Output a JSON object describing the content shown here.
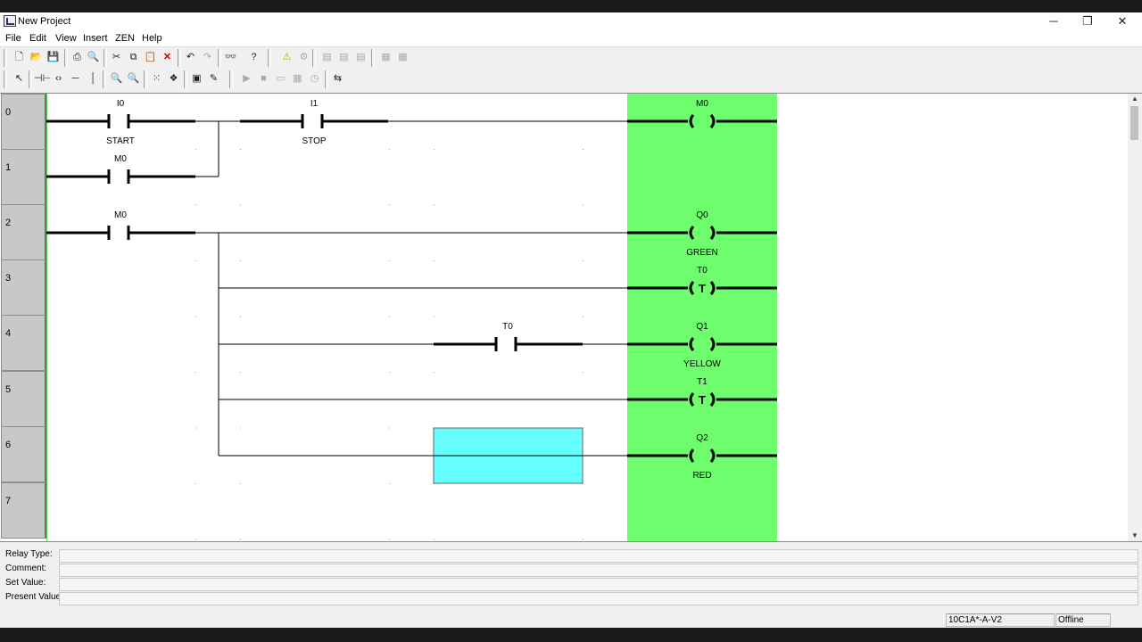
{
  "window": {
    "title": "New Project",
    "controls": {
      "minimize": "─",
      "maximize": "❐",
      "close": "✕"
    }
  },
  "menu": [
    "File",
    "Edit",
    "View",
    "Insert",
    "ZEN",
    "Help"
  ],
  "toolbar1": [
    "new-file-icon",
    "open-folder-icon",
    "save-icon",
    "print-icon",
    "print-preview-icon",
    "cut-icon",
    "copy-icon",
    "paste-icon",
    "delete-icon",
    "undo-icon",
    "redo-icon",
    "find-icon",
    "help-icon",
    "warning-icon",
    "compile-icon",
    "disabled-tool-1",
    "disabled-tool-2",
    "disabled-tool-3",
    "disabled-tool-4",
    "disabled-tool-5"
  ],
  "toolbar2": [
    "pointer-icon",
    "contact-icon",
    "coil-icon",
    "horizontal-line-icon",
    "vertical-line-icon",
    "zoom-in-icon",
    "zoom-out-icon",
    "grid-icon",
    "layers-icon",
    "comment-icon",
    "edit-icon",
    "run-icon",
    "stop-icon",
    "monitor-icon",
    "table-icon",
    "clock-icon",
    "transfer-icon"
  ],
  "rows": [
    "0",
    "1",
    "2",
    "3",
    "4",
    "5",
    "6",
    "7"
  ],
  "ladder": {
    "contacts": [
      {
        "addr": "I0",
        "comment": "START"
      },
      {
        "addr": "I1",
        "comment": "STOP"
      },
      {
        "addr": "M0",
        "comment": ""
      },
      {
        "addr": "M0",
        "comment": ""
      },
      {
        "addr": "T0",
        "comment": ""
      }
    ],
    "coils": [
      {
        "addr": "M0",
        "symbol": "",
        "comment": ""
      },
      {
        "addr": "Q0",
        "symbol": "",
        "comment": "GREEN"
      },
      {
        "addr": "T0",
        "symbol": "T",
        "comment": ""
      },
      {
        "addr": "Q1",
        "symbol": "",
        "comment": "YELLOW"
      },
      {
        "addr": "T1",
        "symbol": "T",
        "comment": ""
      },
      {
        "addr": "Q2",
        "symbol": "",
        "comment": "RED"
      }
    ],
    "coil_column_color": "#6dfd6d",
    "cursor_color": "#66ffff"
  },
  "properties": {
    "relay_type": "Relay Type:",
    "comment": "Comment:",
    "set_value": "Set Value:",
    "present_value": "Present Value:"
  },
  "status": {
    "model": "10C1A*-A-V2",
    "mode": "Offline"
  }
}
